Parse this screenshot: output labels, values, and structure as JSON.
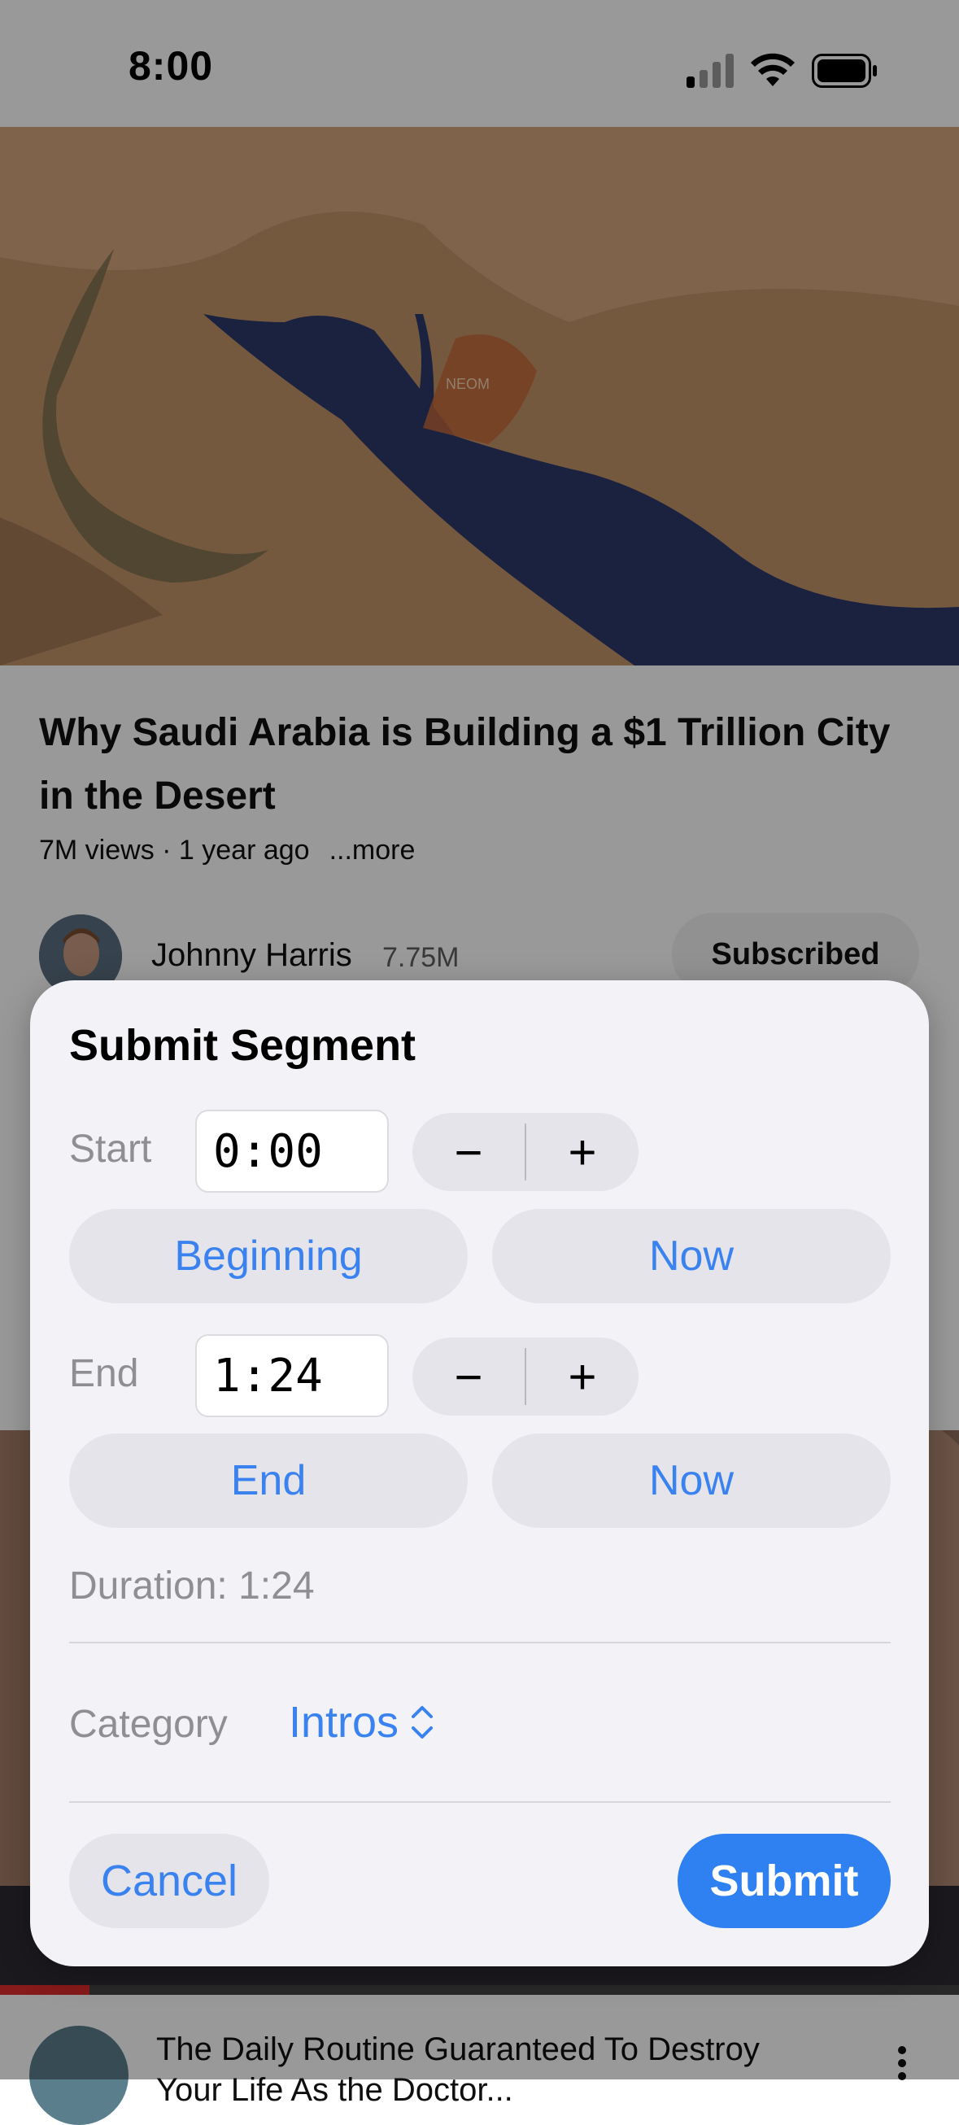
{
  "status_bar": {
    "time": "8:00"
  },
  "video": {
    "title": "Why Saudi Arabia is Building a $1 Trillion City in the Desert",
    "map_label": "NEOM",
    "views": "7M views · 1 year ago",
    "more_label": "...more"
  },
  "channel": {
    "name": "Johnny Harris",
    "subscribers": "7.75M",
    "subscribe_label": "Subscribed"
  },
  "next_video": {
    "title": "The Daily Routine Guaranteed To Destroy Your Life As the Doctor..."
  },
  "modal": {
    "title": "Submit Segment",
    "start": {
      "label": "Start",
      "value": "0:00",
      "minus": "−",
      "plus": "+",
      "left_button": "Beginning",
      "right_button": "Now"
    },
    "end": {
      "label": "End",
      "value": "1:24",
      "minus": "−",
      "plus": "+",
      "left_button": "End",
      "right_button": "Now"
    },
    "duration": "Duration: 1:24",
    "category_label": "Category",
    "category_value": "Intros",
    "cancel_label": "Cancel",
    "submit_label": "Submit"
  },
  "colors": {
    "accent": "#3a82f0",
    "submit": "#2f80f0",
    "modal_bg": "#f2f2f7",
    "pill_bg": "#e4e4ea"
  }
}
